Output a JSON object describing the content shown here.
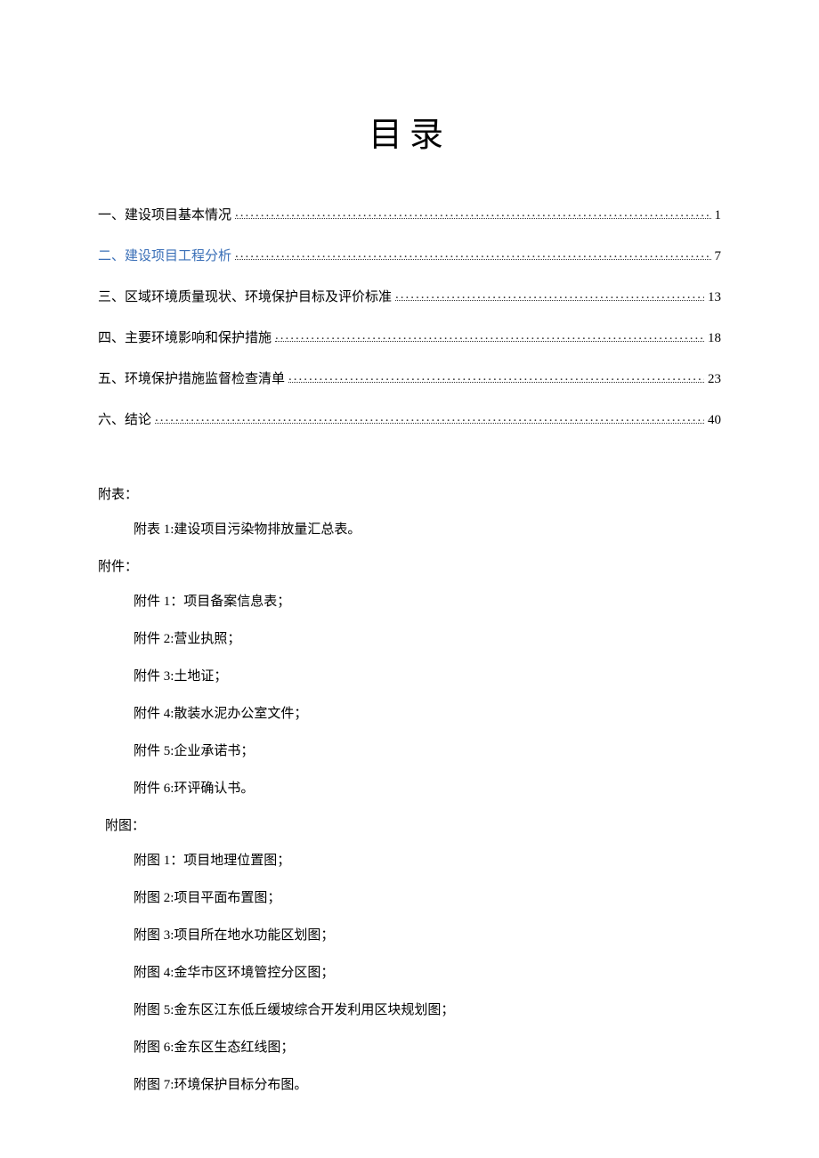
{
  "title": "目录",
  "toc": [
    {
      "label": "一、建设项目基本情况",
      "page": "1",
      "link": false
    },
    {
      "label": "二、建设项目工程分析",
      "page": "7",
      "link": true
    },
    {
      "label": "三、区域环境质量现状、环境保护目标及评价标准",
      "page": "13",
      "link": false
    },
    {
      "label": "四、主要环境影响和保护措施",
      "page": "18",
      "link": false
    },
    {
      "label": "五、环境保护措施监督检查清单",
      "page": "23",
      "link": false
    },
    {
      "label": "六、结论",
      "page": "40",
      "link": false
    }
  ],
  "appendix_tables": {
    "heading": "附表：",
    "items": [
      "附表 1:建设项目污染物排放量汇总表。"
    ]
  },
  "attachments": {
    "heading": "附件：",
    "items": [
      "附件 1：项目备案信息表；",
      "附件 2:营业执照；",
      "附件 3:土地证；",
      "附件 4:散装水泥办公室文件；",
      "附件 5:企业承诺书；",
      "附件 6:环评确认书。"
    ]
  },
  "figures": {
    "heading": "附图：",
    "items": [
      "附图 1：项目地理位置图；",
      "附图 2:项目平面布置图；",
      "附图 3:项目所在地水功能区划图；",
      "附图 4:金华市区环境管控分区图；",
      "附图 5:金东区江东低丘缓坡综合开发利用区块规划图；",
      "附图 6:金东区生态红线图；",
      "附图 7:环境保护目标分布图。"
    ]
  }
}
